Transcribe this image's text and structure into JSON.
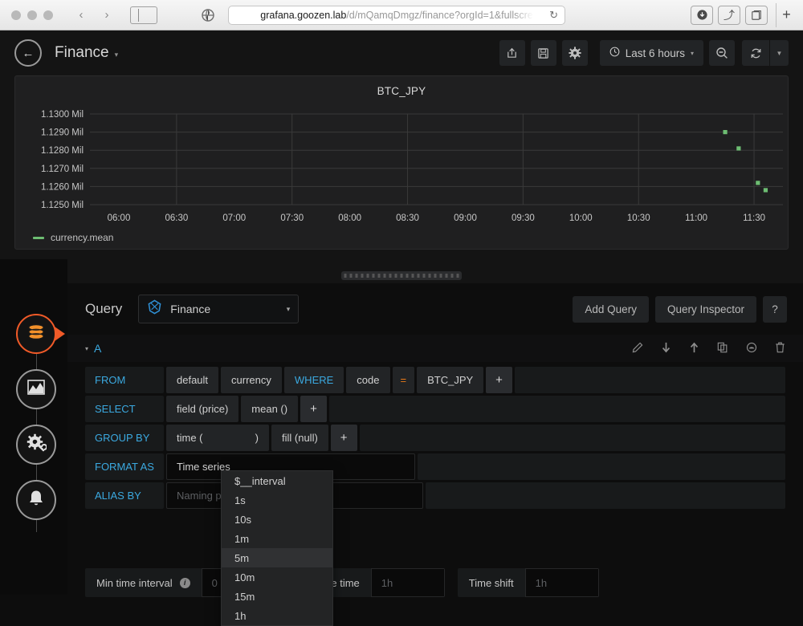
{
  "browser": {
    "url_host": "grafana.goozen.lab",
    "url_path": "/d/mQamqDmgz/finance?orgId=1&fullscre",
    "back_icon": "‹",
    "forward_icon": "›",
    "reload_icon": "↻",
    "download_icon": "⬇",
    "share_icon": "⤴",
    "tabs_icon": "❐",
    "new_tab_icon": "+"
  },
  "header": {
    "back_icon": "←",
    "title": "Finance",
    "caret": "▼",
    "share_icon": "↱",
    "save_icon": "💾",
    "settings_icon": "⚙",
    "time_icon": "◴",
    "time_range": "Last 6 hours",
    "time_caret": "▼",
    "zoom_out_icon": "⊙",
    "refresh_icon": "↻",
    "refresh_caret": "▼"
  },
  "panel": {
    "title": "BTC_JPY",
    "legend_label": "currency.mean",
    "legend_color": "#6dbd72"
  },
  "chart_data": {
    "type": "scatter",
    "title": "BTC_JPY",
    "xlabel": "",
    "ylabel": "",
    "x_ticks": [
      "06:00",
      "06:30",
      "07:00",
      "07:30",
      "08:00",
      "08:30",
      "09:00",
      "09:30",
      "10:00",
      "10:30",
      "11:00",
      "11:30"
    ],
    "y_ticks": [
      "1.1250 Mil",
      "1.1260 Mil",
      "1.1270 Mil",
      "1.1280 Mil",
      "1.1290 Mil",
      "1.1300 Mil"
    ],
    "ylim": [
      1125000,
      1130000
    ],
    "grid": true,
    "legend_position": "bottom-left",
    "series": [
      {
        "name": "currency.mean",
        "color": "#6dbd72",
        "points": [
          {
            "x": "11:15",
            "y": 1129000
          },
          {
            "x": "11:22",
            "y": 1128100
          },
          {
            "x": "11:32",
            "y": 1126200
          },
          {
            "x": "11:36",
            "y": 1125800
          }
        ]
      }
    ]
  },
  "editor_nav": {
    "items": [
      {
        "name": "queries",
        "icon": "database-icon",
        "active": true
      },
      {
        "name": "visualization",
        "icon": "graph-icon",
        "active": false
      },
      {
        "name": "general",
        "icon": "gear-wrench-icon",
        "active": false
      },
      {
        "name": "alert",
        "icon": "bell-icon",
        "active": false
      }
    ]
  },
  "query": {
    "label": "Query",
    "datasource": "Finance",
    "datasource_caret": "▼",
    "add_query": "Add Query",
    "query_inspector": "Query Inspector",
    "help": "?",
    "row_letter": "A",
    "row_caret": "▼",
    "row_icons": [
      {
        "name": "edit-icon",
        "glyph": "✎"
      },
      {
        "name": "move-down-icon",
        "glyph": "⬇"
      },
      {
        "name": "move-up-icon",
        "glyph": "⬆"
      },
      {
        "name": "duplicate-icon",
        "glyph": "⧉"
      },
      {
        "name": "hide-icon",
        "glyph": "◉"
      },
      {
        "name": "delete-icon",
        "glyph": "🗑"
      }
    ],
    "rows": {
      "from": {
        "key": "FROM",
        "policy": "default",
        "measurement": "currency",
        "where": "WHERE",
        "tag": "code",
        "operator": "=",
        "value": "BTC_JPY",
        "add": "+"
      },
      "select": {
        "key": "SELECT",
        "field": "field (price)",
        "func": "mean ()",
        "add": "+"
      },
      "group_by": {
        "key": "GROUP BY",
        "time_open": "time (",
        "time_close": ")",
        "fill": "fill (null)",
        "add": "+"
      },
      "format_as": {
        "key": "FORMAT AS",
        "value": "Time series"
      },
      "alias_by": {
        "key": "ALIAS BY",
        "placeholder": "Naming pattern"
      }
    }
  },
  "dropdown": {
    "name": "group-by-time-interval-dropdown",
    "selected": "5m",
    "options": [
      "$__interval",
      "1s",
      "10s",
      "1m",
      "5m",
      "10m",
      "15m",
      "1h"
    ]
  },
  "options": {
    "min_time_interval_label": "Min time interval",
    "min_time_interval_placeholder": "0",
    "relative_time_label": "Relative time",
    "relative_time_placeholder": "1h",
    "time_shift_label": "Time shift",
    "time_shift_placeholder": "1h"
  }
}
